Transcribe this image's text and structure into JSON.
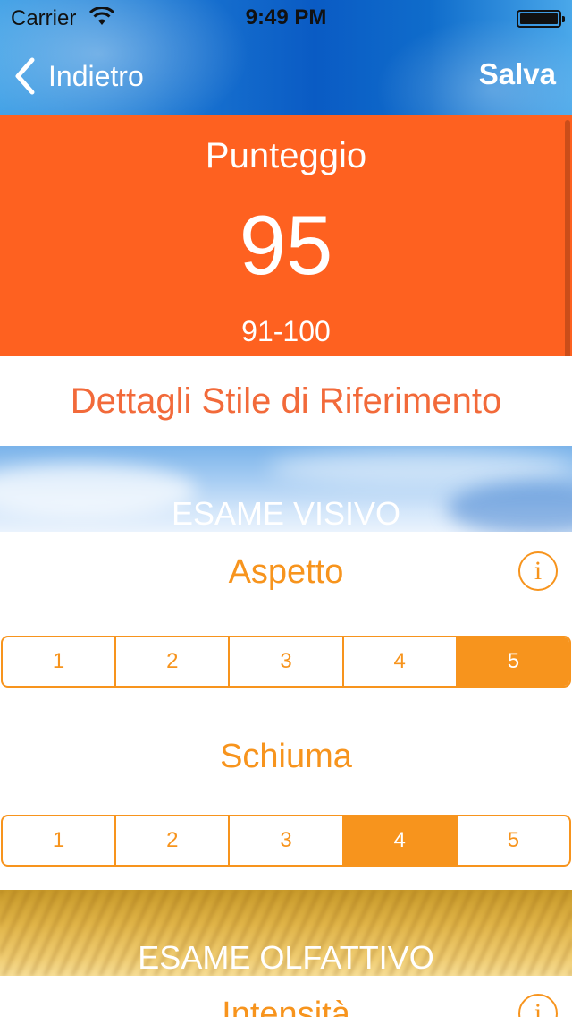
{
  "status_bar": {
    "carrier": "Carrier",
    "time": "9:49 PM"
  },
  "nav": {
    "back_label": "Indietro",
    "save_label": "Salva"
  },
  "score": {
    "title": "Punteggio",
    "value": "95",
    "range": "91-100"
  },
  "details_link": "Dettagli Stile di Riferimento",
  "sections": {
    "visivo": {
      "title": "ESAME VISIVO"
    },
    "olfattivo": {
      "title": "ESAME OLFATTIVO"
    }
  },
  "ratings": {
    "aspetto": {
      "label": "Aspetto",
      "options": [
        "1",
        "2",
        "3",
        "4",
        "5"
      ],
      "selected": "5"
    },
    "schiuma": {
      "label": "Schiuma",
      "options": [
        "1",
        "2",
        "3",
        "4",
        "5"
      ],
      "selected": "4"
    },
    "intensita": {
      "label": "Intensità"
    }
  },
  "colors": {
    "accent_orange": "#f7941d",
    "score_background": "#fe6120",
    "details_text": "#f26a3a"
  }
}
